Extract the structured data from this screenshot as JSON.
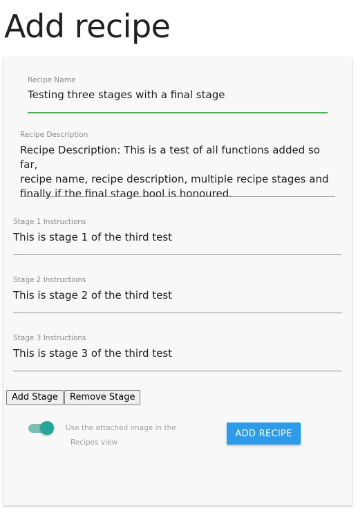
{
  "page": {
    "title": "Add recipe"
  },
  "form": {
    "recipe_name": {
      "label": "Recipe Name",
      "value": "Testing three stages with a final stage"
    },
    "recipe_description": {
      "label": "Recipe Description",
      "value": "Recipe Description: This is a test of all functions added so far,\nrecipe name, recipe description, multiple recipe stages and\nfinally if the final stage bool is honoured."
    },
    "stages": [
      {
        "label": "Stage 1 Instructions",
        "value": "This is stage 1 of the third test"
      },
      {
        "label": "Stage 2 Instructions",
        "value": "This is stage 2 of the third test"
      },
      {
        "label": "Stage 3 Instructions",
        "value": "This is stage 3 of the third test"
      }
    ],
    "add_stage_label": "Add Stage",
    "remove_stage_label": "Remove Stage",
    "toggle": {
      "on": true,
      "label_line1": "Use the attached image in the",
      "label_line2": "Recipes view"
    },
    "submit_label": "ADD RECIPE"
  },
  "colors": {
    "focus_underline": "#4caf50",
    "toggle_thumb": "#26a69a",
    "toggle_track": "#7fbfb3",
    "primary_button": "#2f9ae8"
  }
}
